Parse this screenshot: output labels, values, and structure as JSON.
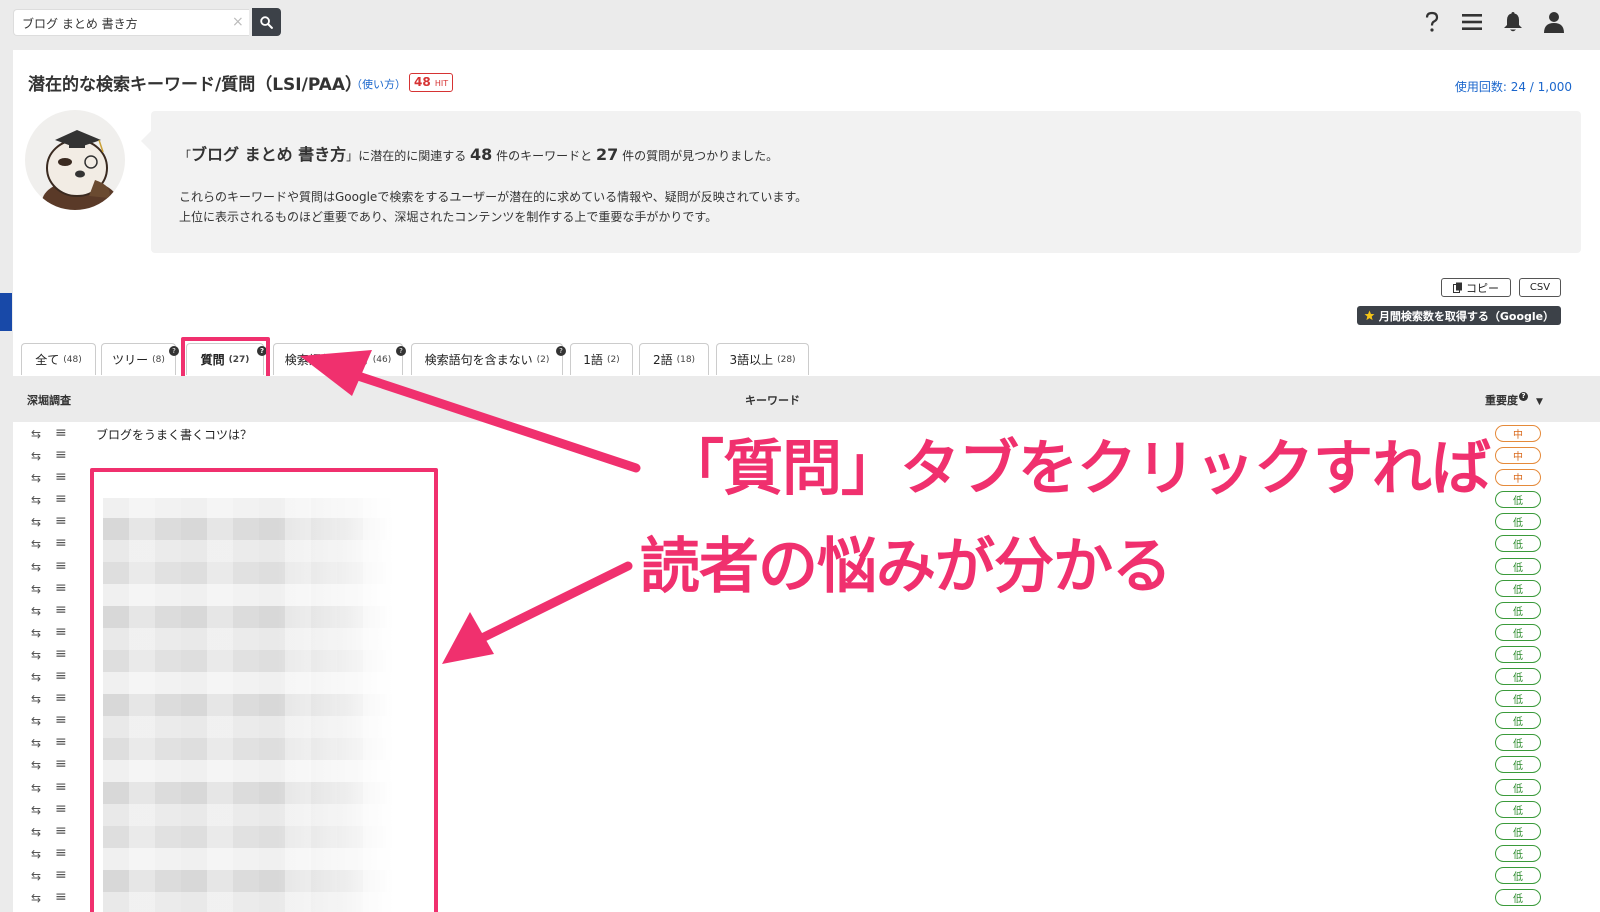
{
  "search": {
    "value": "ブログ まとめ 書き方",
    "clear": "×"
  },
  "header": {
    "title": "潜在的な検索キーワード/質問（LSI/PAA）",
    "howto": "（使い方）",
    "hit_count": "48",
    "hit_unit": "HIT",
    "usage": "使用回数: 24 / 1,000"
  },
  "info": {
    "q_open": "「",
    "keyword": "ブログ まとめ 書き方",
    "q_close": "」",
    "mid1": "に潜在的に関連する",
    "kw_count": "48",
    "mid2": "件のキーワードと",
    "q_count": "27",
    "mid3": "件の質問が見つかりました。",
    "line2": "これらのキーワードや質問はGoogleで検索をするユーザーが潜在的に求めている情報や、疑問が反映されています。",
    "line3": "上位に表示されるものほど重要であり、深堀されたコンテンツを制作する上で重要な手がかりです。"
  },
  "actions": {
    "copy": "コピー",
    "csv": "CSV",
    "monthly": "月間検索数を取得する（Google）"
  },
  "tabs": [
    {
      "label": "全て",
      "count": "(48)"
    },
    {
      "label": "ツリー",
      "count": "(8)"
    },
    {
      "label": "質問",
      "count": "(27)"
    },
    {
      "label": "検索語句を含む",
      "count": "(46)"
    },
    {
      "label": "検索語句を含まない",
      "count": "(2)"
    },
    {
      "label": "1語",
      "count": "(2)"
    },
    {
      "label": "2語",
      "count": "(18)"
    },
    {
      "label": "3語以上",
      "count": "(28)"
    }
  ],
  "table": {
    "col_dig": "深堀調査",
    "col_kw": "キーワード",
    "col_imp": "重要度",
    "first_keyword": "ブログをうまく書くコツは？",
    "importance": [
      "中",
      "中",
      "中",
      "低",
      "低",
      "低",
      "低",
      "低",
      "低",
      "低",
      "低",
      "低",
      "低",
      "低",
      "低",
      "低",
      "低",
      "低",
      "低",
      "低",
      "低",
      "低"
    ]
  },
  "annotation": {
    "line1": "「質問」タブをクリックすれば",
    "line2": "読者の悩みが分かる"
  },
  "colors": {
    "accent": "#f0306e",
    "link": "#1a66cc",
    "dark": "#3c4148"
  }
}
